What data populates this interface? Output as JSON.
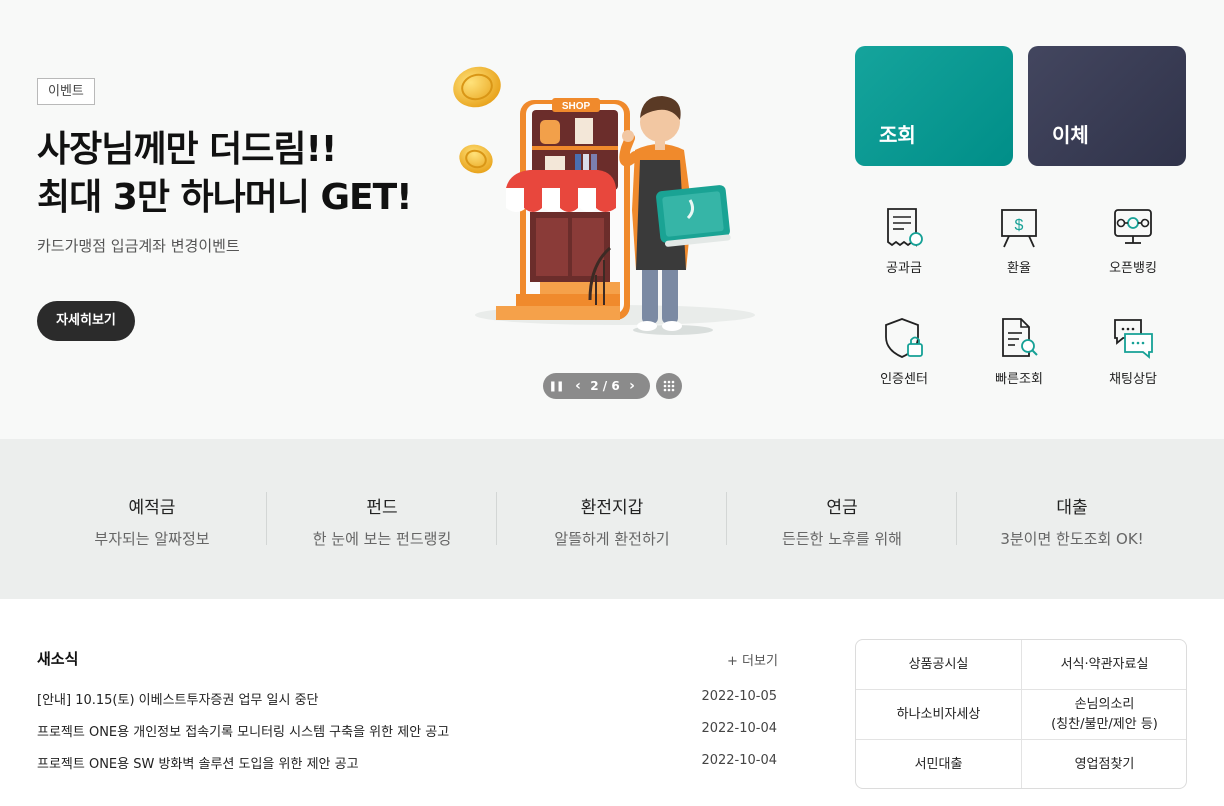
{
  "hero": {
    "badge": "이벤트",
    "title_line1": "사장님께만 더드림!!",
    "title_line2": "최대 3만 하나머니 GET!",
    "subtitle": "카드가맹점 입금계좌 변경이벤트",
    "detail_button": "자세히보기",
    "illustration_sign": "SHOP",
    "pager": {
      "pause_icon": "pause-icon",
      "counter": "2 / 6"
    }
  },
  "quick": {
    "inquiry": "조회",
    "transfer": "이체",
    "inquiry_color": "#0e9b94",
    "transfer_color": "#393c54"
  },
  "services": [
    {
      "label": "공과금",
      "icon": "bill-icon"
    },
    {
      "label": "환율",
      "icon": "exchange-board-icon"
    },
    {
      "label": "오픈뱅킹",
      "icon": "open-banking-icon"
    },
    {
      "label": "인증센터",
      "icon": "shield-lock-icon"
    },
    {
      "label": "빠른조회",
      "icon": "document-search-icon"
    },
    {
      "label": "채팅상담",
      "icon": "chat-icon"
    }
  ],
  "categories": [
    {
      "title": "예적금",
      "sub": "부자되는 알짜정보"
    },
    {
      "title": "펀드",
      "sub": "한 눈에 보는 펀드랭킹"
    },
    {
      "title": "환전지갑",
      "sub": "알뜰하게 환전하기"
    },
    {
      "title": "연금",
      "sub": "든든한 노후를 위해"
    },
    {
      "title": "대출",
      "sub": "3분이면 한도조회 OK!"
    }
  ],
  "news": {
    "title": "새소식",
    "more": "+ 더보기",
    "items": [
      {
        "title": "[안내] 10.15(토) 이베스트투자증권 업무 일시 중단",
        "date": "2022-10-05"
      },
      {
        "title": "프로젝트 ONE용 개인정보 접속기록 모니터링 시스템 구축을 위한 제안 공고",
        "date": "2022-10-04"
      },
      {
        "title": "프로젝트 ONE용 SW 방화벽 솔루션 도입을 위한 제안 공고",
        "date": "2022-10-04"
      }
    ]
  },
  "links": {
    "product_notice": "상품공시실",
    "forms": "서식·약관자료실",
    "consumer": "하나소비자세상",
    "voice_line1": "손님의소리",
    "voice_line2": "(칭찬/불만/제안 등)",
    "low_income_loan": "서민대출",
    "branch_finder": "영업점찾기"
  }
}
